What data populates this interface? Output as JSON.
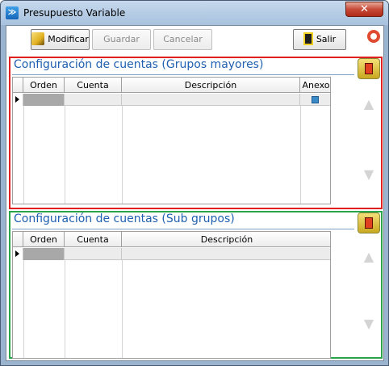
{
  "window": {
    "title": "Presupuesto Variable",
    "close_label": "✕",
    "app_icon": "app-icon"
  },
  "toolbar": {
    "modificar_label": "Modificar",
    "guardar_label": "Guardar",
    "cancelar_label": "Cancelar",
    "salir_label": "Salir"
  },
  "section1": {
    "title": "Configuración de cuentas (Grupos mayores)",
    "columns": [
      "Orden",
      "Cuenta",
      "Descripción",
      "Anexo"
    ]
  },
  "section2": {
    "title": "Configuración de cuentas (Sub grupos)",
    "columns": [
      "Orden",
      "Cuenta",
      "Descripción"
    ]
  },
  "colors": {
    "accent_red": "#e02020",
    "accent_green": "#2aa44a",
    "title_blue": "#2060b0"
  }
}
